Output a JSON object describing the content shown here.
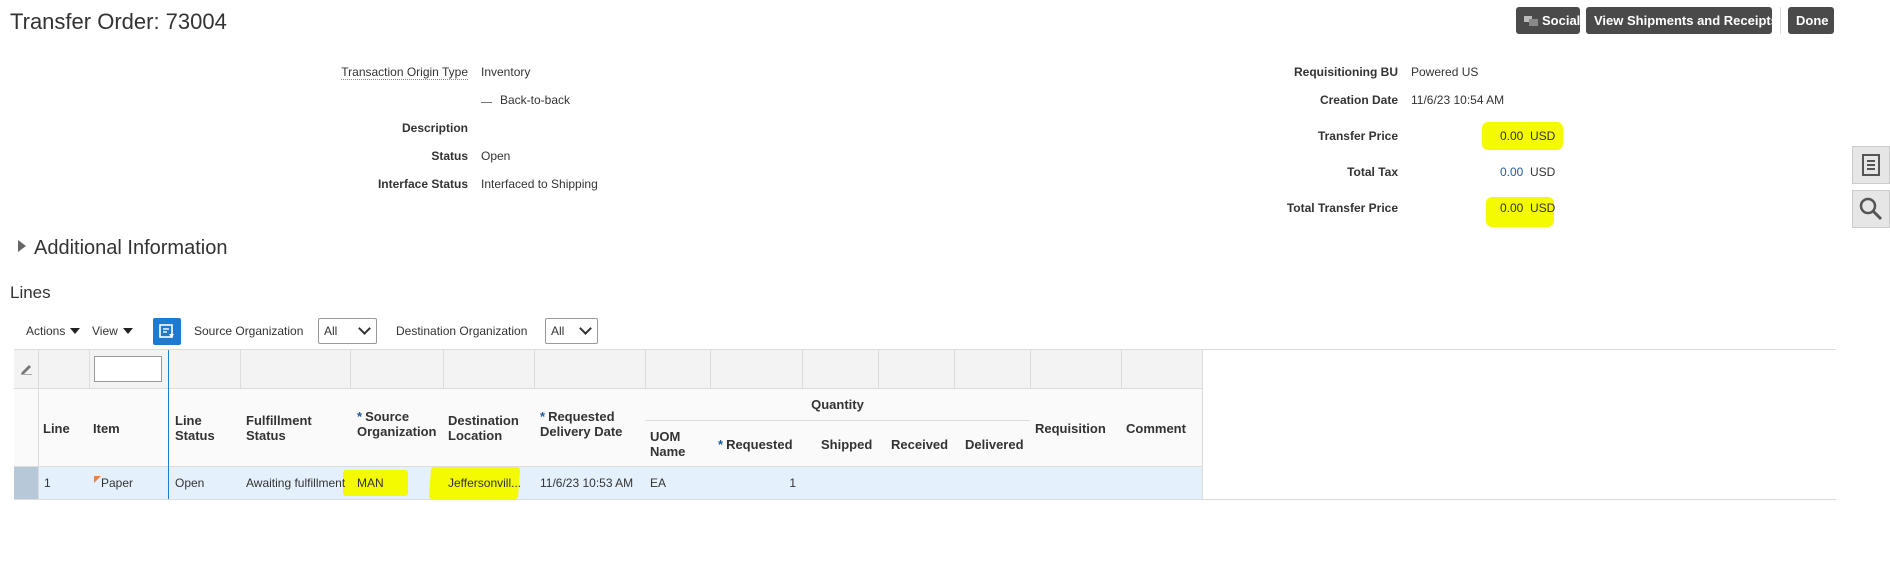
{
  "header": {
    "title": "Transfer Order: 73004",
    "buttons": {
      "social": "Social",
      "view_shipments": "View Shipments and Receipts",
      "done": "Done"
    }
  },
  "details_left": {
    "transaction_origin_type": {
      "label": "Transaction Origin Type",
      "value": "Inventory",
      "sub_value": "Back-to-back"
    },
    "description": {
      "label": "Description",
      "value": ""
    },
    "status": {
      "label": "Status",
      "value": "Open"
    },
    "interface_status": {
      "label": "Interface Status",
      "value": "Interfaced to Shipping"
    }
  },
  "details_right": {
    "requisitioning_bu": {
      "label": "Requisitioning BU",
      "value": "Powered US"
    },
    "creation_date": {
      "label": "Creation Date",
      "value": "11/6/23 10:54 AM"
    },
    "transfer_price": {
      "label": "Transfer Price",
      "value": "0.00",
      "currency": "USD"
    },
    "total_tax": {
      "label": "Total Tax",
      "value": "0.00",
      "currency": "USD"
    },
    "total_transfer_price": {
      "label": "Total Transfer Price",
      "value": "0.00",
      "currency": "USD"
    }
  },
  "additional_information": {
    "label": "Additional Information"
  },
  "lines": {
    "title": "Lines",
    "toolbar": {
      "actions": "Actions",
      "view": "View",
      "source_org_label": "Source Organization",
      "source_org_value": "All",
      "dest_org_label": "Destination Organization",
      "dest_org_value": "All"
    },
    "columns": {
      "line": "Line",
      "item": "Item",
      "line_status": "Line Status",
      "fulfillment_status": "Fulfillment Status",
      "source_organization": "Source Organization",
      "destination_location": "Destination Location",
      "requested_delivery_date": "Requested Delivery Date",
      "quantity_group": "Quantity",
      "uom_name": "UOM Name",
      "requested": "Requested",
      "shipped": "Shipped",
      "received": "Received",
      "delivered": "Delivered",
      "requisition": "Requisition",
      "comment": "Comment"
    },
    "rows": [
      {
        "line": "1",
        "item": "Paper",
        "line_status": "Open",
        "fulfillment_status": "Awaiting fulfillment",
        "source_organization": "MAN",
        "destination_location": "Jeffersonvill...",
        "requested_delivery_date": "11/6/23 10:53 AM",
        "uom_name": "EA",
        "requested": "1",
        "shipped": "",
        "received": "",
        "delivered": "",
        "requisition": "",
        "comment": ""
      }
    ]
  },
  "colors": {
    "highlight": "#f4fb00",
    "link": "#1d5b9f",
    "selected_row": "#e4f0fb",
    "button_dark": "#4a4a4a"
  }
}
